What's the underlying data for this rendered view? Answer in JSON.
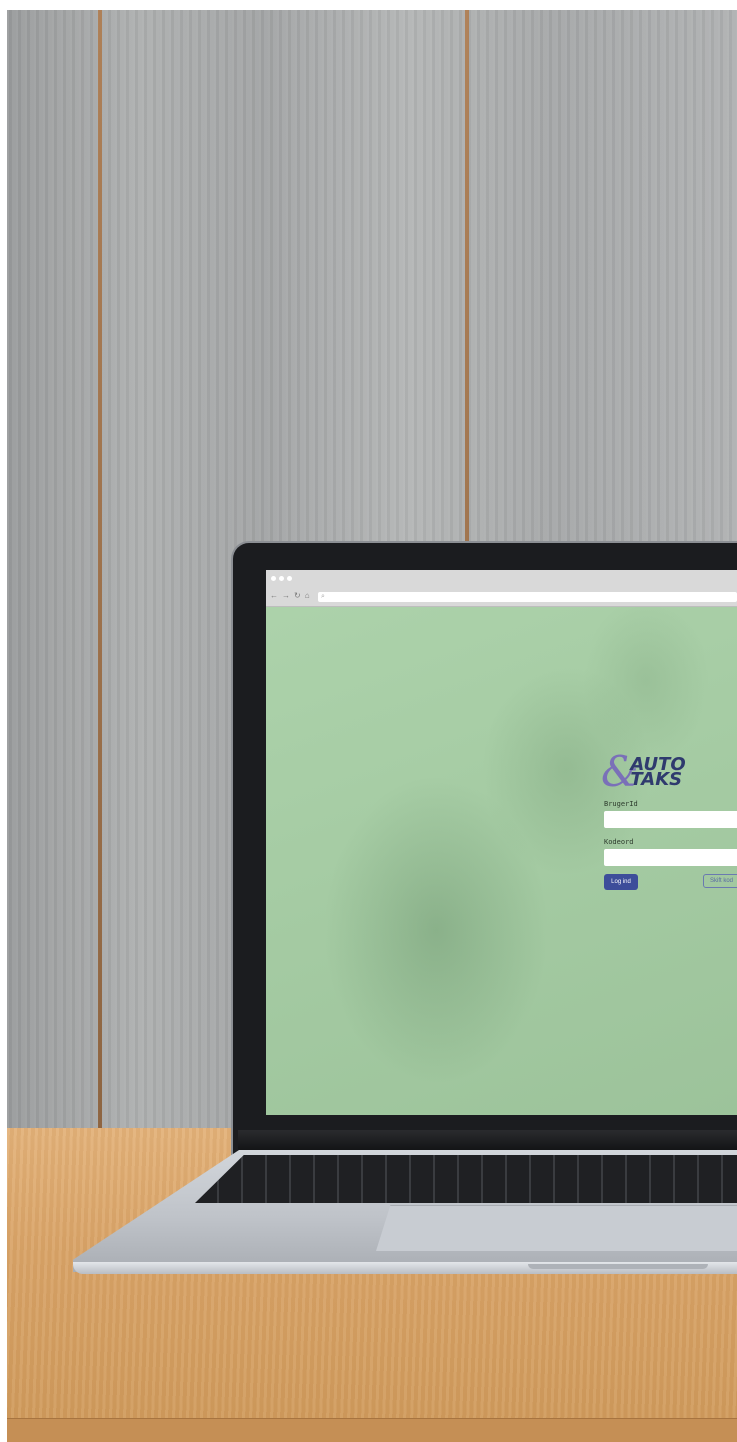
{
  "login": {
    "logo_line1": "AUTO",
    "logo_line2": "TAKS",
    "logo_mark": "&",
    "user_label": "BrugerId",
    "user_value": "",
    "password_label": "Kodeord",
    "password_value": "",
    "login_button": "Log ind",
    "change_button": "Skift kod"
  },
  "browser": {
    "nav_icons": [
      "back-arrow-icon",
      "forward-arrow-icon",
      "reload-icon",
      "home-icon"
    ],
    "url_value": ""
  },
  "colors": {
    "screen_bg": "#a6cfa4",
    "primary_button": "#3d4d9a",
    "logo_text": "#2f3a6e",
    "logo_mark": "#7a70b8"
  }
}
